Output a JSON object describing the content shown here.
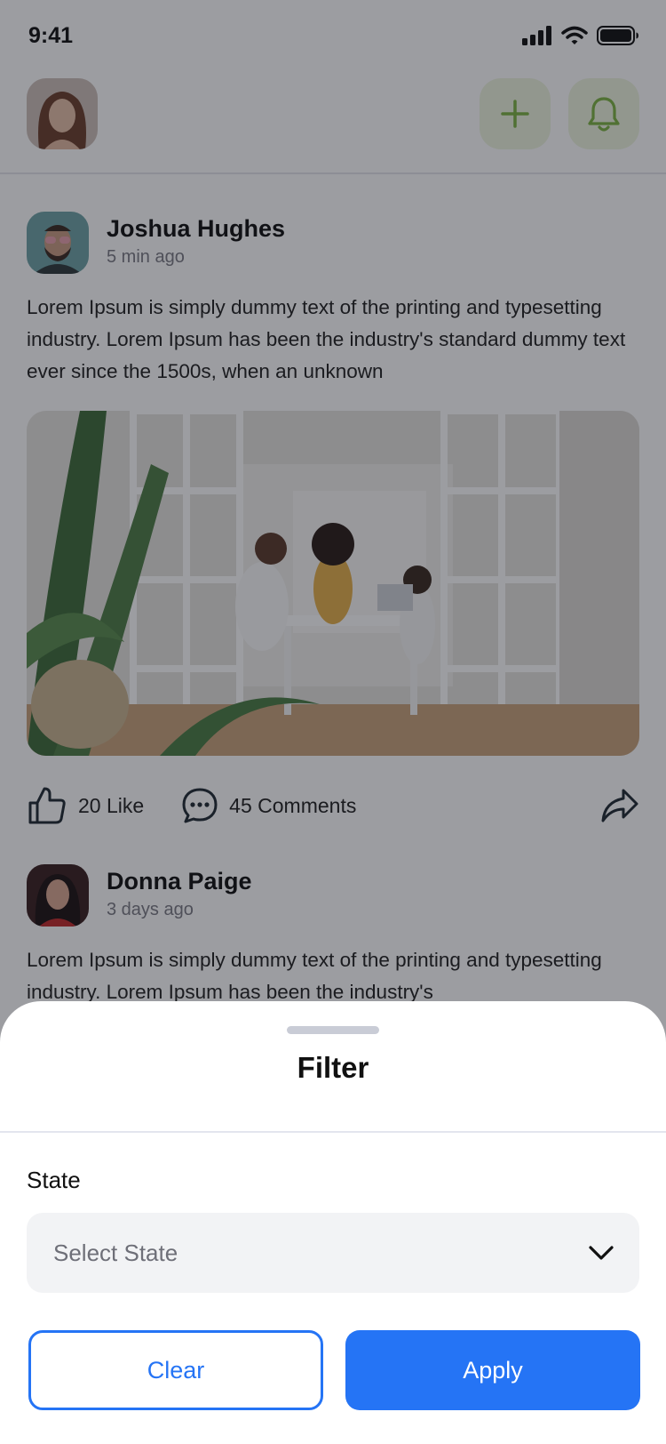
{
  "status_bar": {
    "time": "9:41"
  },
  "header": {
    "add_icon": "plus-icon",
    "notification_icon": "bell-icon",
    "accent_color": "#7cb342"
  },
  "posts": [
    {
      "author": "Joshua Hughes",
      "time": "5 min ago",
      "text": "Lorem Ipsum is simply dummy text of the printing and typesetting industry. Lorem Ipsum has been the industry's standard dummy text ever since the 1500s, when an unknown",
      "likes": "20 Like",
      "comments": "45 Comments"
    },
    {
      "author": "Donna Paige",
      "time": "3 days ago",
      "text": "Lorem Ipsum is simply dummy text of the printing and typesetting industry. Lorem Ipsum has been the industry's"
    }
  ],
  "filter_sheet": {
    "title": "Filter",
    "state_label": "State",
    "state_placeholder": "Select State",
    "clear_label": "Clear",
    "apply_label": "Apply",
    "primary_color": "#2574f5"
  }
}
